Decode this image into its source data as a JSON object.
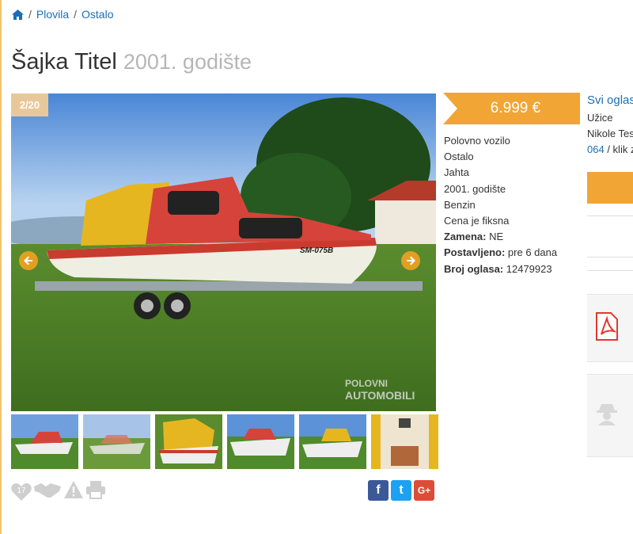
{
  "breadcrumb": {
    "items": [
      "Plovila",
      "Ostalo"
    ],
    "separator": "/"
  },
  "listing": {
    "title": "Šajka Titel",
    "subtitle": "2001. godište",
    "photo_counter": "2/20",
    "watermark_line1": "POLOVNI",
    "watermark_line2": "AUTOMOBILI",
    "boat_registration": "SM-075B",
    "price": "6.999 €",
    "details": [
      "Polovno vozilo",
      "Ostalo",
      "Jahta",
      "2001. godište",
      "Benzin",
      "Cena je fiksna"
    ],
    "details_labeled": [
      {
        "label": "Zamena:",
        "value": "NE"
      },
      {
        "label": "Postavljeno:",
        "value": "pre 6 dana"
      },
      {
        "label": "Broj oglasa:",
        "value": "12479923"
      }
    ],
    "favorites_count": "17"
  },
  "seller": {
    "all_ads_link": "Svi oglasi",
    "city": "Užice",
    "address": "Nikole Tesle",
    "phone_prefix": "064",
    "phone_hint": "/ klik za broj"
  },
  "social": {
    "facebook": "f",
    "twitter": "t",
    "google_plus": "G+"
  },
  "colors": {
    "accent": "#f0a535",
    "link": "#1a6fb5",
    "pdf_red": "#e03a2f"
  },
  "icons": [
    "home-icon",
    "arrow-left-icon",
    "arrow-right-icon",
    "heart-icon",
    "handshake-icon",
    "warning-icon",
    "print-icon",
    "pdf-icon",
    "spy-icon"
  ]
}
